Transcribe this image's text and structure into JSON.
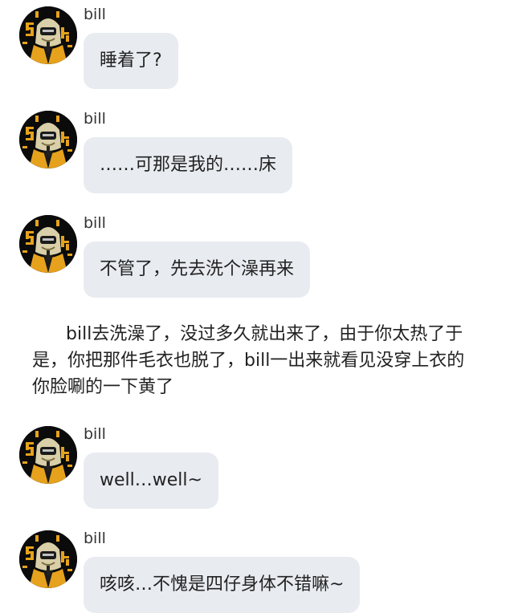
{
  "messages": [
    {
      "sender": "bill",
      "text": "睡着了?"
    },
    {
      "sender": "bill",
      "text": "……可那是我的……床"
    },
    {
      "sender": "bill",
      "text": "不管了，先去洗个澡再来"
    },
    {
      "sender": "bill",
      "text": "well…well~"
    },
    {
      "sender": "bill",
      "text": "咳咳…不愧是四仔身体不错嘛~"
    }
  ],
  "narration": {
    "text": "bill去洗澡了，没过多久就出来了，由于你太热了于是，你把那件毛衣也脱了，bill一出来就看见没穿上衣的你脸唰的一下黄了"
  },
  "colors": {
    "bubble_bg": "#e8ebf0",
    "avatar_bg": "#0b0b0b",
    "avatar_accent": "#e6a21c"
  }
}
